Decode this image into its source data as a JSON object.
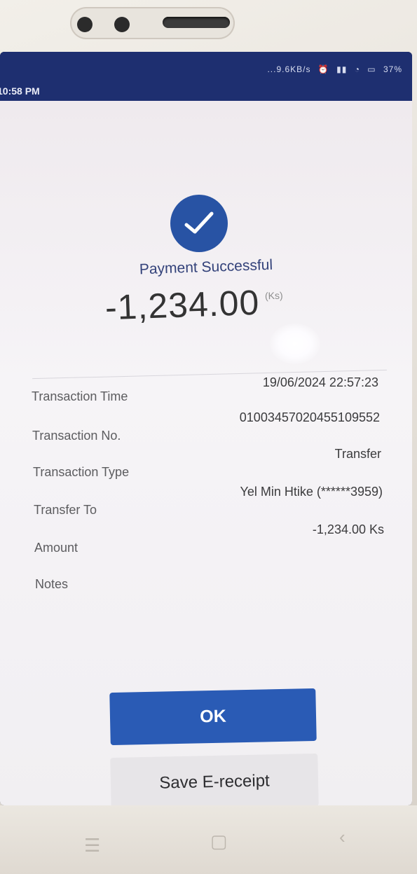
{
  "status_bar": {
    "time": "10:58 PM",
    "network_speed": "...9.6KB/s",
    "battery": "37%"
  },
  "payment": {
    "status_title": "Payment Successful",
    "amount": "-1,234.00",
    "currency_badge": "(Ks)"
  },
  "details": [
    {
      "label": "Transaction Time",
      "value": "19/06/2024 22:57:23"
    },
    {
      "label": "Transaction No.",
      "value": "01003457020455109552"
    },
    {
      "label": "Transaction Type",
      "value": "Transfer"
    },
    {
      "label": "Transfer To",
      "value": "Yel Min Htike (******3959)"
    },
    {
      "label": "Amount",
      "value": "-1,234.00 Ks"
    },
    {
      "label": "Notes",
      "value": ""
    }
  ],
  "buttons": {
    "ok_label": "OK",
    "save_receipt_label": "Save E-receipt"
  },
  "icons": {
    "success": "check-icon",
    "nav_menu": "menu-icon",
    "nav_home": "home-icon",
    "nav_back": "back-icon"
  },
  "colors": {
    "accent": "#2a5bb5",
    "status_bar": "#1e2f70",
    "title": "#33427a"
  }
}
